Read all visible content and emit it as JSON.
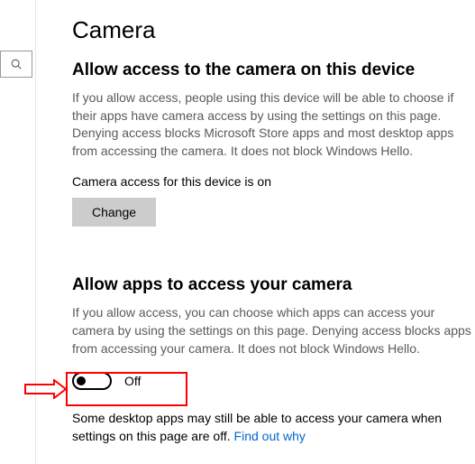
{
  "search": {
    "placeholder": ""
  },
  "page": {
    "title": "Camera"
  },
  "section1": {
    "heading": "Allow access to the camera on this device",
    "desc": "If you allow access, people using this device will be able to choose if their apps have camera access by using the settings on this page. Denying access blocks Microsoft Store apps and most desktop apps from accessing the camera. It does not block Windows Hello.",
    "status": "Camera access for this device is on",
    "change_label": "Change"
  },
  "section2": {
    "heading": "Allow apps to access your camera",
    "desc": "If you allow access, you can choose which apps can access your camera by using the settings on this page. Denying access blocks apps from accessing your camera. It does not block Windows Hello.",
    "toggle_state": "Off",
    "footnote_text": "Some desktop apps may still be able to access your camera when settings on this page are off. ",
    "footnote_link": "Find out why"
  }
}
